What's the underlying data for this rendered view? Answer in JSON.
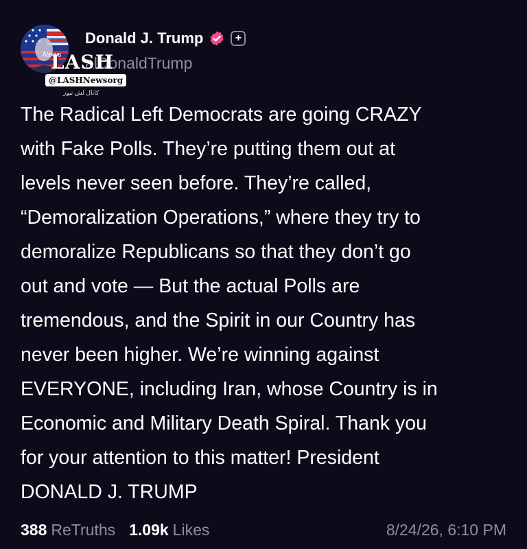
{
  "author": {
    "display_name": "Donald J. Trump",
    "handle_visible": "alDonaldTrump"
  },
  "icons": {
    "verified": "verified-badge-icon",
    "follow": "plus-icon"
  },
  "watermark": {
    "news_word": "News",
    "logo_text": "LASH",
    "badge": "@LASHNewsorg",
    "subtitle": "کانال لش نیوز"
  },
  "post": {
    "text": "The Radical Left Democrats are going CRAZY\nwith Fake Polls. They’re putting them out at\nlevels never seen before. They’re called,\n“Demoralization Operations,” where they try to\ndemoralize Republicans so that they don’t go\nout and vote — But the actual Polls are\ntremendous, and the Spirit in our Country has\nnever been higher. We’re winning against\nEVERYONE, including Iran, whose Country is in\nEconomic and Military Death Spiral. Thank you\nfor your attention to this matter! President\nDONALD J. TRUMP"
  },
  "stats": {
    "retruths_count": "388",
    "retruths_label": "ReTruths",
    "likes_count": "1.09k",
    "likes_label": "Likes",
    "timestamp": "8/24/26, 6:10 PM"
  },
  "colors": {
    "background": "#0d0b1a",
    "text": "#ffffff",
    "muted": "#8e8ca3",
    "verified": "#f04a8a"
  }
}
